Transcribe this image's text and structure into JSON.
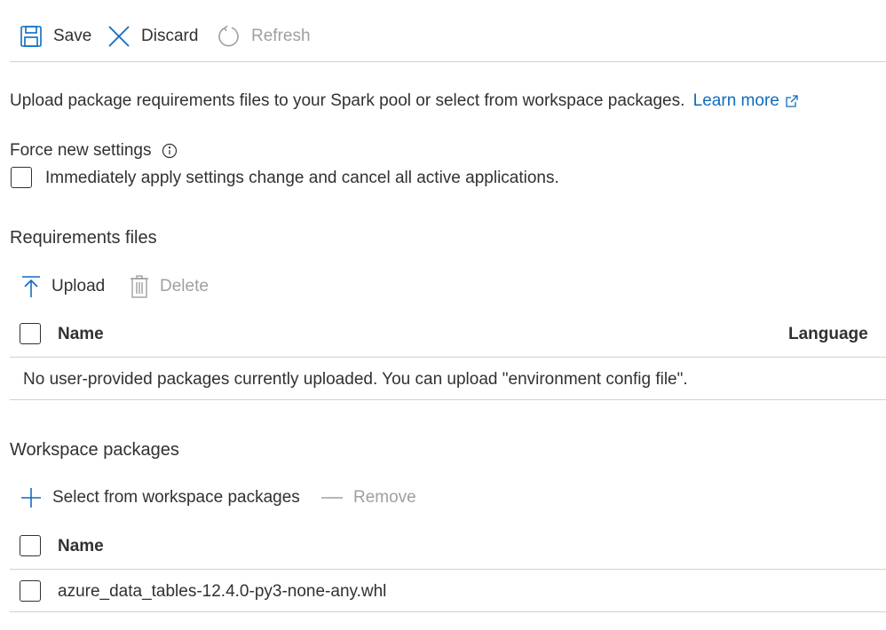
{
  "toolbar": {
    "save_label": "Save",
    "discard_label": "Discard",
    "refresh_label": "Refresh"
  },
  "intro": {
    "text": "Upload package requirements files to your Spark pool or select from workspace packages.",
    "learn_more": "Learn more"
  },
  "force": {
    "label": "Force new settings",
    "checkbox_label": "Immediately apply settings change and cancel all active applications."
  },
  "requirements": {
    "title": "Requirements files",
    "upload_label": "Upload",
    "delete_label": "Delete",
    "col_name": "Name",
    "col_language": "Language",
    "empty_message": "No user-provided packages currently uploaded. You can upload \"environment config file\"."
  },
  "workspace": {
    "title": "Workspace packages",
    "select_label": "Select from workspace packages",
    "remove_label": "Remove",
    "col_name": "Name",
    "rows": [
      "azure_data_tables-12.4.0-py3-none-any.whl"
    ]
  },
  "colors": {
    "accent": "#0f6cbd",
    "text": "#323130",
    "disabled": "#a19f9d",
    "divider": "#d2d0ce"
  }
}
